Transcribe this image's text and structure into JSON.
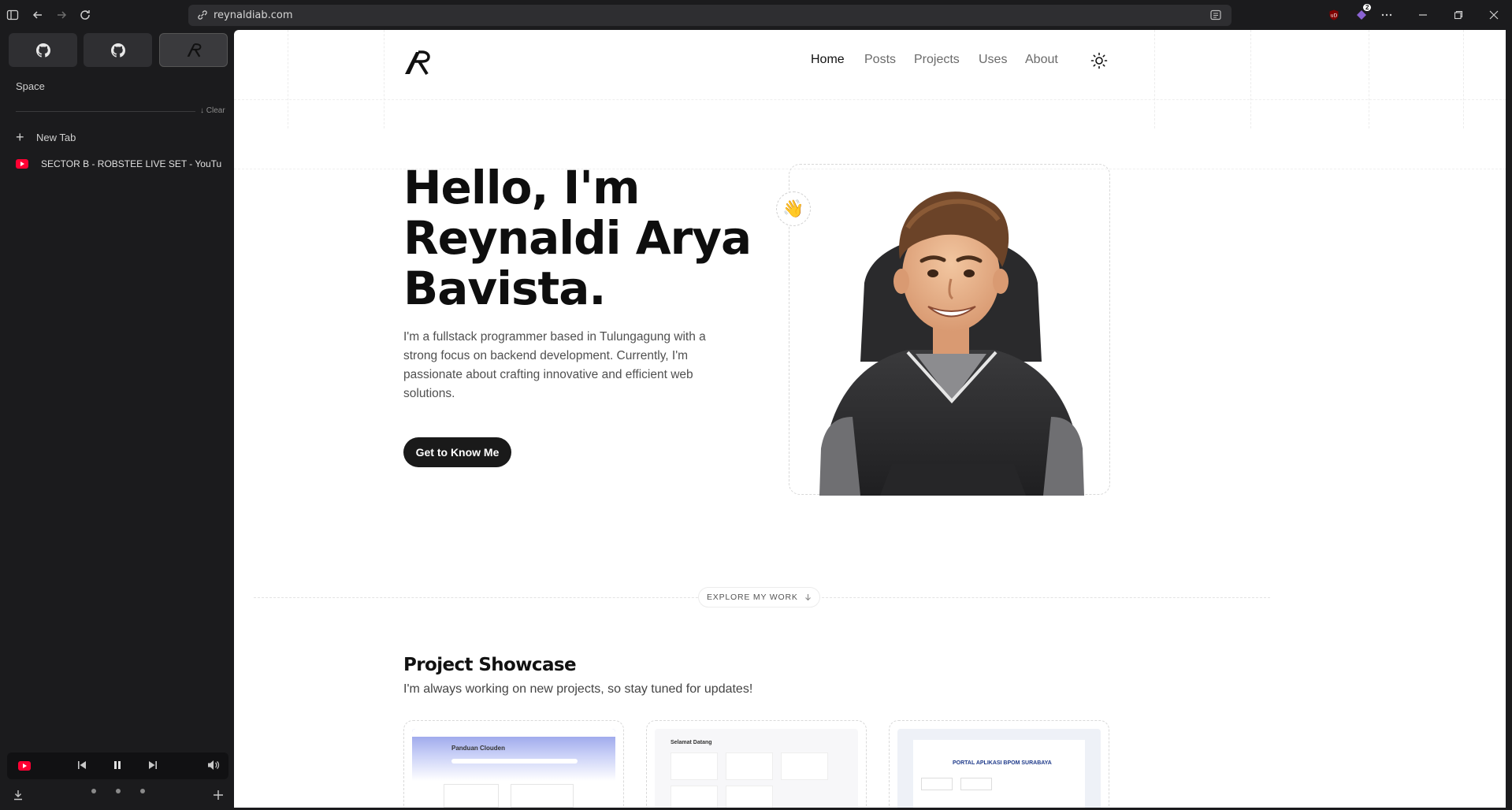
{
  "browser": {
    "url": "reynaldiab.com",
    "extensions_badge": "2"
  },
  "sidebar": {
    "space_label": "Space",
    "clear_label": "↓ Clear",
    "new_tab_label": "New Tab",
    "tabs": [
      {
        "title": "SECTOR B - ROBSTEE LIVE SET - YouTube"
      }
    ]
  },
  "site": {
    "nav": [
      "Home",
      "Posts",
      "Projects",
      "Uses",
      "About"
    ],
    "hero": {
      "line1": "Hello, I'm",
      "line2": "Reynaldi Arya",
      "line3": "Bavista.",
      "description": "I'm a fullstack programmer based in Tulungagung with a strong focus on backend development. Currently, I'm passionate about crafting innovative and efficient web solutions.",
      "cta": "Get to Know Me"
    },
    "explore_label": "EXPLORE MY WORK",
    "showcase": {
      "title": "Project Showcase",
      "subtitle": "I'm always working on new projects, so stay tuned for updates!",
      "cards": [
        {
          "thumb_title": "Panduan Clouden"
        },
        {
          "thumb_title": "Selamat Datang"
        },
        {
          "thumb_title": "PORTAL APLIKASI BPOM SURABAYA"
        }
      ]
    }
  },
  "colors": {
    "browser_bg": "#1b1b1d",
    "page_bg": "#ffffff",
    "primary_dark": "#1a1a1a",
    "youtube_red": "#ff0033"
  }
}
